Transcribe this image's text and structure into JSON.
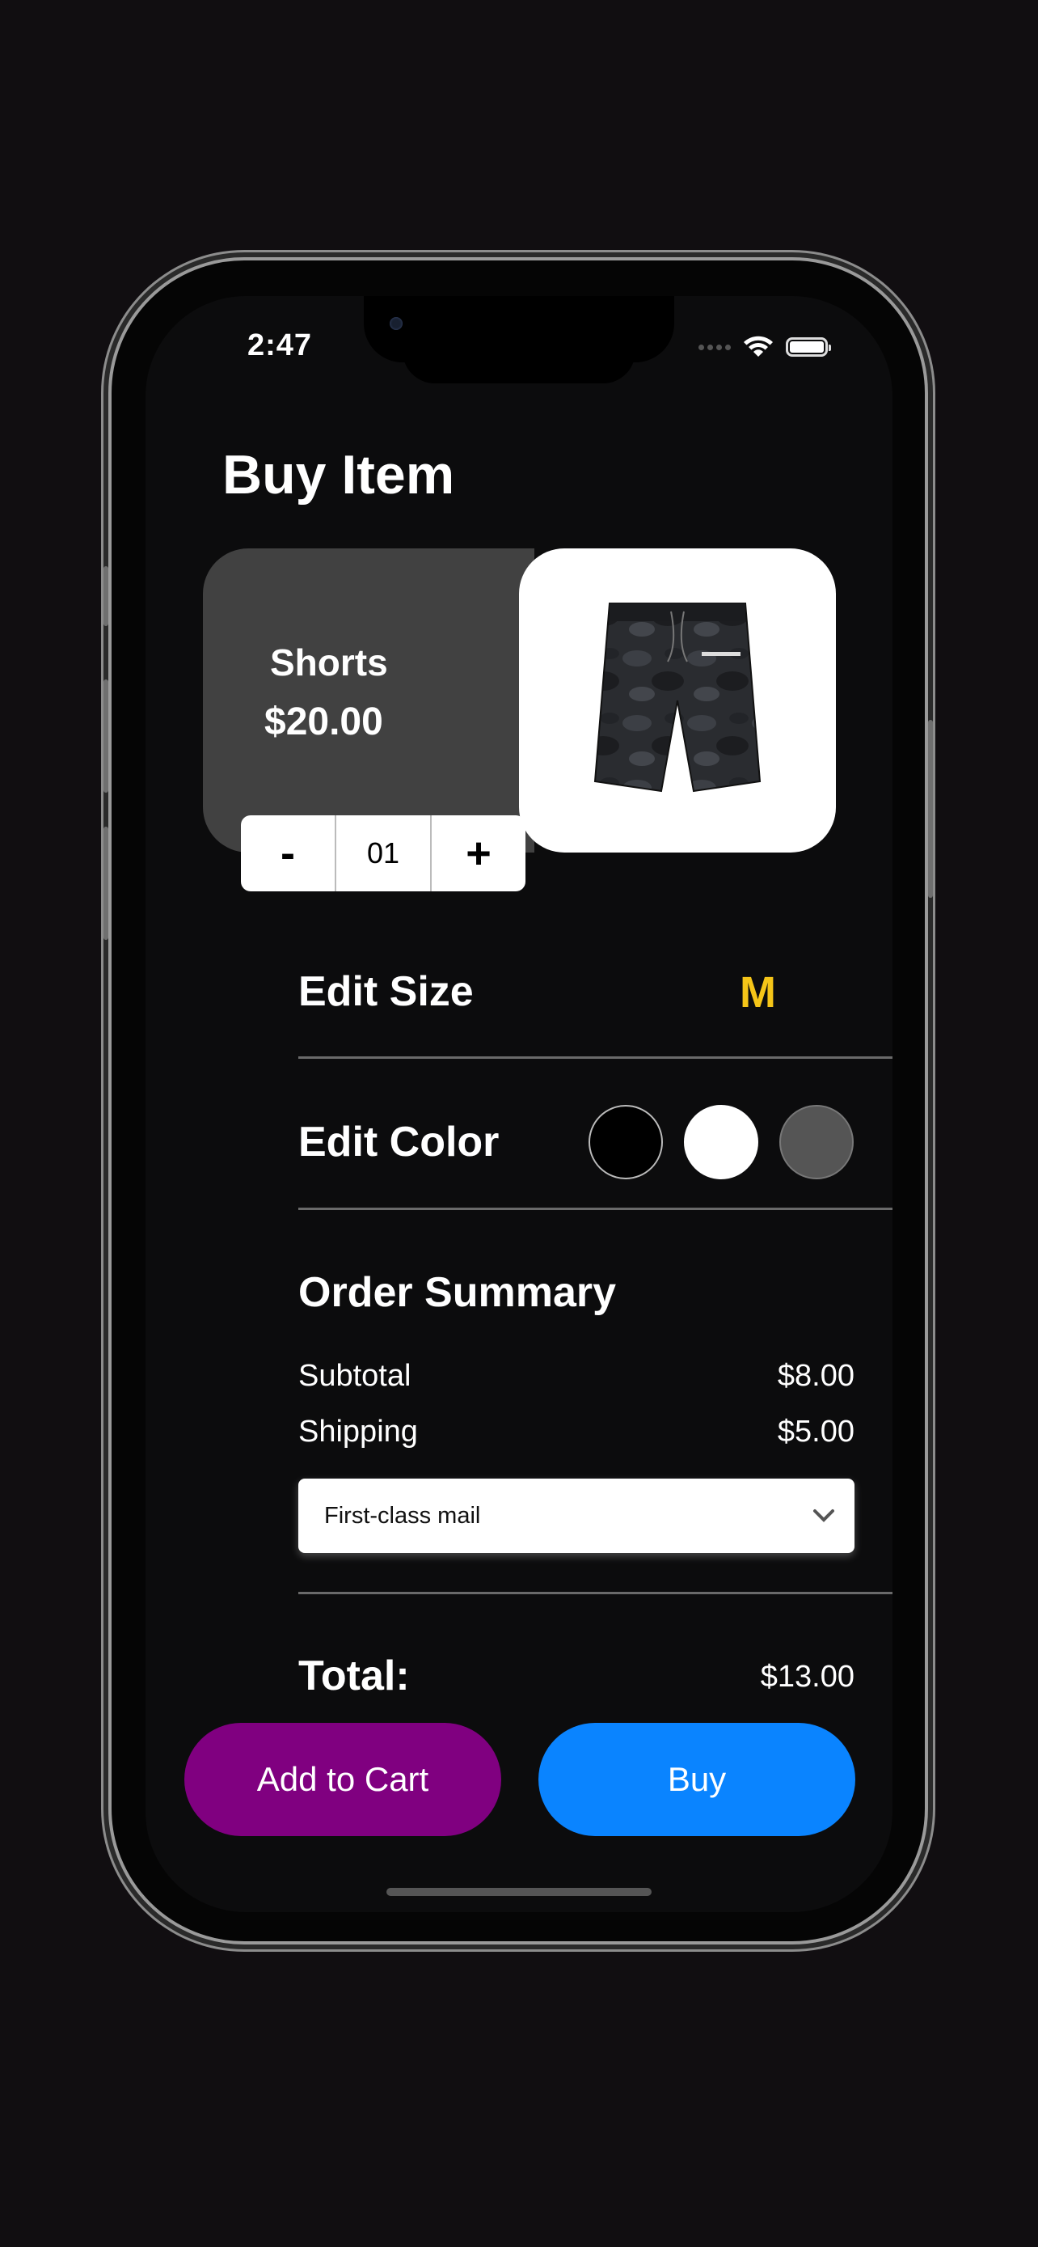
{
  "status_bar": {
    "time": "2:47",
    "icons": [
      "signal-dots",
      "wifi-icon",
      "battery-icon"
    ]
  },
  "page": {
    "title": "Buy Item"
  },
  "product": {
    "name": "Shorts",
    "price": "$20.00",
    "image": "camo-shorts-image",
    "quantity": "01",
    "decrement_label": "-",
    "increment_label": "+"
  },
  "size": {
    "label": "Edit Size",
    "value": "M",
    "value_color": "#f5c518"
  },
  "color": {
    "label": "Edit Color",
    "swatches": [
      "#000000",
      "#ffffff",
      "#555555"
    ]
  },
  "summary": {
    "heading": "Order Summary",
    "subtotal_label": "Subtotal",
    "subtotal_value": "$8.00",
    "shipping_label": "Shipping",
    "shipping_value": "$5.00",
    "shipping_method": "First-class mail"
  },
  "total": {
    "label": "Total:",
    "value": "$13.00"
  },
  "actions": {
    "add_to_cart": "Add to Cart",
    "add_to_cart_color": "#800080",
    "buy": "Buy",
    "buy_color": "#0a84ff"
  }
}
